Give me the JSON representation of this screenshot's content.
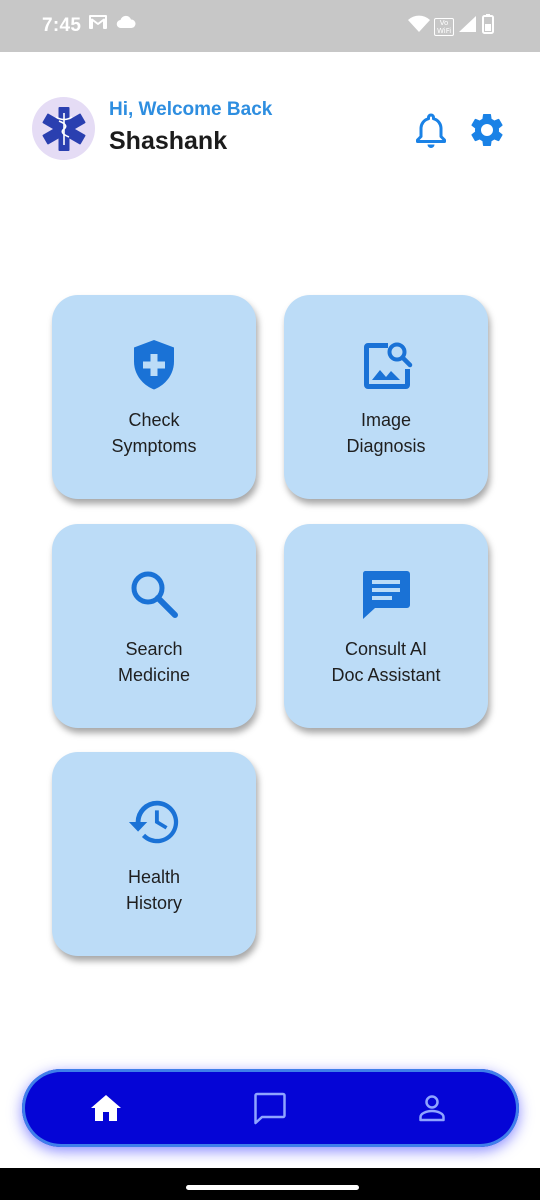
{
  "status_bar": {
    "time": "7:45",
    "vowifi_top": "Vo",
    "vowifi_bottom": "WiFi"
  },
  "header": {
    "greeting": "Hi, Welcome Back",
    "user_name": "Shashank"
  },
  "cards": [
    {
      "line1": "Check",
      "line2": "Symptoms",
      "icon": "shield-plus-icon"
    },
    {
      "line1": "Image",
      "line2": "Diagnosis",
      "icon": "image-search-icon"
    },
    {
      "line1": "Search",
      "line2": "Medicine",
      "icon": "search-icon"
    },
    {
      "line1": "Consult AI",
      "line2": "Doc Assistant",
      "icon": "chat-icon"
    },
    {
      "line1": "Health",
      "line2": "History",
      "icon": "history-icon"
    }
  ],
  "bottom_nav": {
    "items": [
      "home-icon",
      "chat-outline-icon",
      "profile-icon"
    ],
    "active": "home-icon"
  },
  "colors": {
    "accent": "#2e8ee0",
    "card_bg": "#bcdcf7",
    "icon_blue": "#1a72d6",
    "nav_bg": "#0505d6"
  }
}
